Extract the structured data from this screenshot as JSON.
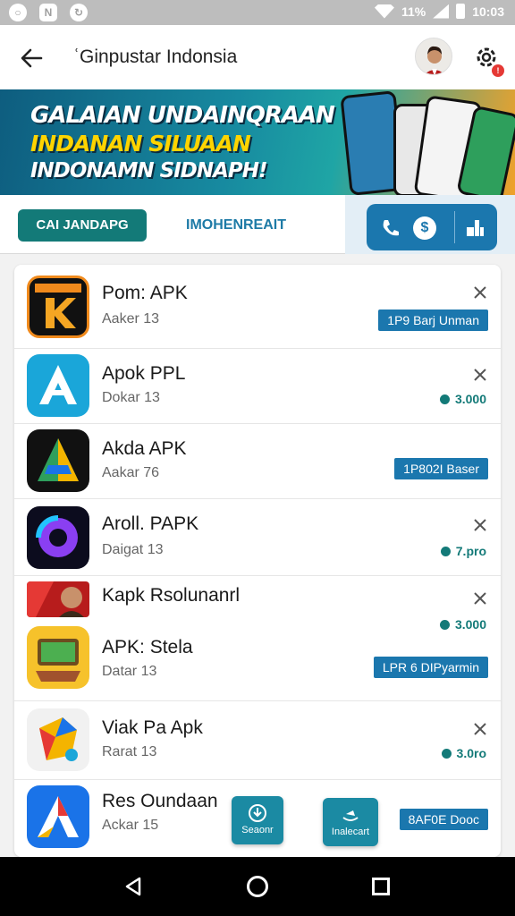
{
  "status_bar": {
    "left_icons": [
      "ring-notification-icon",
      "n-notification-icon",
      "sync-notification-icon"
    ],
    "battery_text": "11%",
    "time": "10:03"
  },
  "app_bar": {
    "title": "ʿGinpustar Indonsia"
  },
  "banner": {
    "line1": "GALAIAN UNDAINQRAAN",
    "line2": "INDANAN SILUAAN",
    "line3": "INDONAMN SIDNAPH!"
  },
  "tabs": {
    "chip_label": "CAI JANDAPG",
    "tab2_label": "IMOHENREAIT",
    "icons": [
      "phone-icon",
      "dollar-icon",
      "grid-icon"
    ]
  },
  "apps": [
    {
      "name": "Pom: APK",
      "sub": "Aaker 13",
      "tag": "1P9 Barj Unman",
      "rating": ""
    },
    {
      "name": "Apok PPL",
      "sub": "Dokar 13",
      "tag": "",
      "rating": "3.000"
    },
    {
      "name": "Akda APK",
      "sub": "Aakar 76",
      "tag": "1P802I Baser",
      "rating": ""
    },
    {
      "name": "Aroll. PAPK",
      "sub": "Daigat 13",
      "tag": "",
      "rating": "7.pro"
    },
    {
      "name": "Kapk Rsolunanrl",
      "sub": "",
      "tag": "",
      "rating": "3.000"
    },
    {
      "name": "APK: Stela",
      "sub": "Datar 13",
      "tag": "LPR 6 DIPyarmin",
      "rating": ""
    },
    {
      "name": "Viak Pa Apk",
      "sub": "Rarat 13",
      "tag": "",
      "rating": "3.0ro"
    },
    {
      "name": "Res Oundaan",
      "sub": "Ackar 15",
      "tag": "8AF0E Dooc",
      "rating": ""
    }
  ],
  "fabs": [
    {
      "label": "Seaonr",
      "icon": "download-icon"
    },
    {
      "label": "Inalecart",
      "icon": "boat-icon"
    }
  ],
  "colors": {
    "accent": "#1b77ae",
    "teal": "#137a78"
  }
}
